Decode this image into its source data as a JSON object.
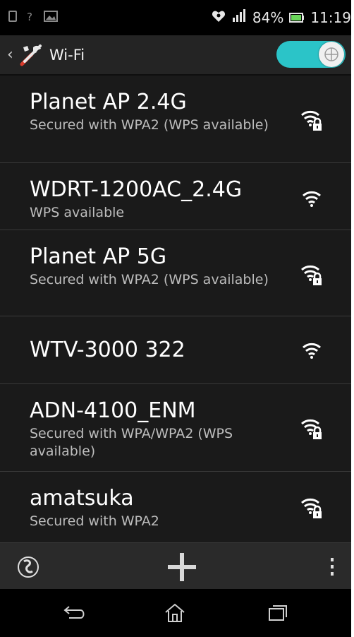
{
  "status_bar": {
    "battery_percent": "84%",
    "time": "11:19"
  },
  "action_bar": {
    "title": "Wi-Fi",
    "toggle_on": true,
    "accent_color": "#2bc4c8"
  },
  "networks": [
    {
      "name": "Planet AP 2.4G",
      "status": "Secured with WPA2 (WPS available)",
      "locked": true
    },
    {
      "name": "WDRT-1200AC_2.4G",
      "status": "WPS available",
      "locked": false
    },
    {
      "name": "Planet AP 5G",
      "status": "Secured with WPA2 (WPS available)",
      "locked": true
    },
    {
      "name": "WTV-3000 322",
      "status": "",
      "locked": false
    },
    {
      "name": "ADN-4100_ENM",
      "status": "Secured with WPA/WPA2 (WPS available)",
      "locked": true
    },
    {
      "name": "amatsuka",
      "status": "Secured with WPA2",
      "locked": true
    }
  ],
  "toolbar": {
    "icons": [
      "wps-icon",
      "add-network-icon",
      "overflow-menu-icon"
    ]
  },
  "nav_bar": {
    "icons": [
      "back-icon",
      "home-icon",
      "recents-icon"
    ]
  }
}
